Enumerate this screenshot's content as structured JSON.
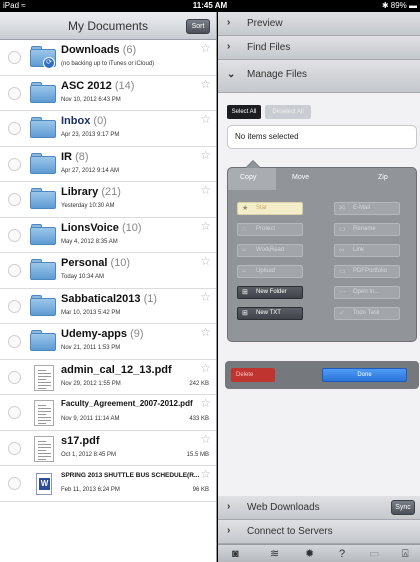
{
  "status_bar": {
    "device": "iPad",
    "wifi_icon": "wifi-icon",
    "time": "11:45 AM",
    "battery": "89%"
  },
  "left_pane": {
    "title": "My Documents",
    "sort_label": "Sort",
    "rows": [
      {
        "kind": "folder-download",
        "name": "Downloads",
        "count": "(6)",
        "subtitle": "(no backing up to iTunes or iCloud)",
        "size": ""
      },
      {
        "kind": "folder",
        "name": "ASC 2012",
        "count": "(14)",
        "subtitle": "Nov 10, 2012 6:43 PM",
        "size": ""
      },
      {
        "kind": "folder",
        "name": "Inbox",
        "count": "(0)",
        "subtitle": "Apr 23, 2013 9:17 PM",
        "size": ""
      },
      {
        "kind": "folder",
        "name": "IR",
        "count": "(8)",
        "subtitle": "Apr 27, 2012 9:14 AM",
        "size": ""
      },
      {
        "kind": "folder",
        "name": "Library",
        "count": "(21)",
        "subtitle": "Yesterday 10:30 AM",
        "size": ""
      },
      {
        "kind": "folder",
        "name": "LionsVoice",
        "count": "(10)",
        "subtitle": "May 4, 2012 8:35 AM",
        "size": ""
      },
      {
        "kind": "folder",
        "name": "Personal",
        "count": "(10)",
        "subtitle": "Today 10:34 AM",
        "size": ""
      },
      {
        "kind": "folder",
        "name": "Sabbatical2013",
        "count": "(1)",
        "subtitle": "Mar 10, 2013 5:42 PM",
        "size": ""
      },
      {
        "kind": "folder",
        "name": "Udemy-apps",
        "count": "(9)",
        "subtitle": "Nov 21, 2011 1:53 PM",
        "size": ""
      },
      {
        "kind": "pdf",
        "name": "admin_cal_12_13.pdf",
        "count": "",
        "subtitle": "Nov 29, 2012 1:55 PM",
        "size": "242 KB"
      },
      {
        "kind": "pdf",
        "name": "Faculty_Agreement_2007-2012.pdf",
        "count": "",
        "subtitle": "Nov 9, 2011 11:14 AM",
        "size": "433 KB"
      },
      {
        "kind": "pdf",
        "name": "s17.pdf",
        "count": "",
        "subtitle": "Oct 1, 2012 8:45 PM",
        "size": "15.5 MB"
      },
      {
        "kind": "word",
        "name": "SPRING 2013 SHUTTLE BUS SCHEDULE(R...",
        "count": "",
        "subtitle": "Feb 11, 2013 6:24 PM",
        "size": "96 KB"
      }
    ]
  },
  "right_pane": {
    "sections": {
      "preview": "Preview",
      "find_files": "Find Files",
      "manage_files": "Manage Files",
      "web_downloads": "Web Downloads",
      "connect_servers": "Connect to Servers"
    },
    "sync_label": "Sync",
    "select_all": "Select All",
    "deselect_all": "Deselect All",
    "selection_status": "No items selected",
    "panel_tabs": {
      "copy": "Copy",
      "move": "Move",
      "zip": "Zip"
    },
    "actions": {
      "star": "Star",
      "email": "E-Mail",
      "protect": "Protect",
      "rename": "Rename",
      "workload": "WorkRead",
      "link": "Link",
      "upload": "Upload",
      "pdf_portfolio": "PDFPortfolio",
      "new_folder": "New Folder",
      "open_in": "Open In...",
      "new_txt": "New TXT",
      "todo_task": "Todo Task"
    },
    "delete_label": "Delete",
    "done_label": "Done"
  },
  "toolbar_icons": [
    "camera-icon",
    "wifi-icon",
    "gear-icon",
    "help-icon",
    "screen-icon",
    "lock-icon"
  ],
  "colors": {
    "accent_blue": "#2a73da",
    "delete_red": "#c0342f",
    "folder_blue": "#5e9bd2"
  }
}
